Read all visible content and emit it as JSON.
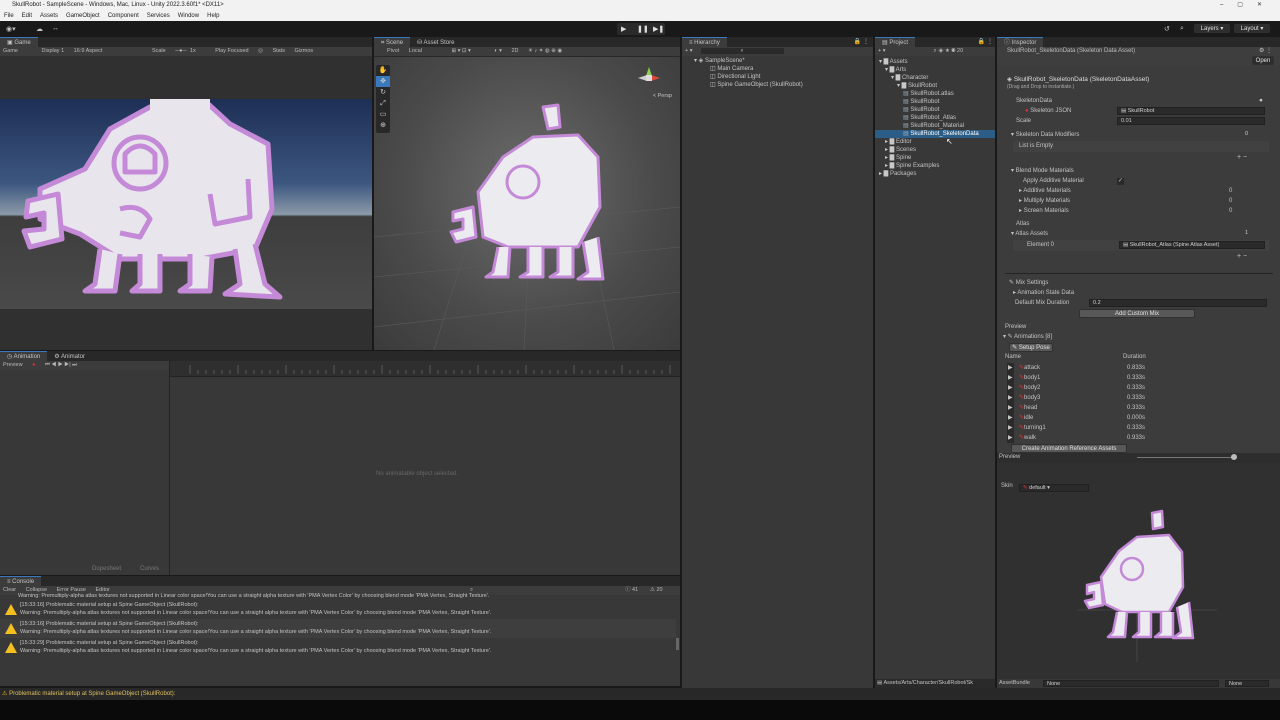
{
  "titlebar": {
    "title": "SkullRobot - SampleScene - Windows, Mac, Linux - Unity 2022.3.60f1* <DX11>"
  },
  "menu": [
    "File",
    "Edit",
    "Assets",
    "GameObject",
    "Component",
    "Services",
    "Window",
    "Help"
  ],
  "toolbar": {
    "layers": "Layers",
    "layout": "Layout"
  },
  "game": {
    "tab": "Game",
    "display_mode": "Game",
    "display": "Display 1",
    "aspect": "16:9 Aspect",
    "scale_label": "Scale",
    "scale_value": "1x",
    "play_focused": "Play Focused",
    "stats": "Stats",
    "gizmos": "Gizmos"
  },
  "scene": {
    "tab": "Scene",
    "asset_store_tab": "Asset Store",
    "pivot": "Pivot",
    "local": "Local",
    "persp": "< Persp",
    "mode_2d": "2D"
  },
  "animation": {
    "tab": "Animation",
    "animator_tab": "Animator",
    "preview": "Preview",
    "empty": "No animatable object selected.",
    "dopesheet": "Dopesheet",
    "curves": "Curves"
  },
  "hierarchy": {
    "tab": "Hierarchy",
    "scene": "SampleScene*",
    "items": [
      "Main Camera",
      "Directional Light",
      "Spine GameObject (SkullRobot)"
    ]
  },
  "project": {
    "tab": "Project",
    "tree": [
      {
        "label": "Assets",
        "depth": 0
      },
      {
        "label": "Arts",
        "depth": 1
      },
      {
        "label": "Character",
        "depth": 2
      },
      {
        "label": "SkullRobot",
        "depth": 3
      },
      {
        "label": "SkullRobot.atlas",
        "depth": 4
      },
      {
        "label": "SkullRobot",
        "depth": 4
      },
      {
        "label": "SkullRobot",
        "depth": 4
      },
      {
        "label": "SkullRobot_Atlas",
        "depth": 4
      },
      {
        "label": "SkullRobot_Material",
        "depth": 4
      },
      {
        "label": "SkullRobot_SkeletonData",
        "depth": 4
      },
      {
        "label": "Editor",
        "depth": 1
      },
      {
        "label": "Scenes",
        "depth": 1
      },
      {
        "label": "Spine",
        "depth": 1
      },
      {
        "label": "Spine Examples",
        "depth": 1
      },
      {
        "label": "Packages",
        "depth": 0
      }
    ],
    "path": "Assets/Arts/Character/SkullRobot/Sk"
  },
  "inspector": {
    "tab": "Inspector",
    "header": "SkullRobot_SkeletonData (Skeleton Data Asset)",
    "open": "Open",
    "asset_title": "SkullRobot_SkeletonData (SkeletonDataAsset)",
    "hint": "(Drag and Drop to instantiate.)",
    "skeleton_data": "SkeletonData",
    "skeleton_json_label": "Skeleton JSON",
    "skeleton_json_value": "SkullRobot",
    "scale_label": "Scale",
    "scale_value": "0.01",
    "modifiers_label": "Skeleton Data Modifiers",
    "modifiers_count": "0",
    "list_empty": "List is Empty",
    "blend_modes": "Blend Mode Materials",
    "apply_additive": "Apply Additive Material",
    "additive": "Additive Materials",
    "multiply": "Multiply Materials",
    "screen": "Screen Materials",
    "zero": "0",
    "atlas": "Atlas",
    "atlas_assets": "Atlas Assets",
    "atlas_count": "1",
    "element0": "Element 0",
    "element0_value": "SkullRobot_Atlas (Spine Atlas Asset)",
    "mix_settings": "Mix Settings",
    "anim_state": "Animation State Data",
    "default_mix": "Default Mix Duration",
    "default_mix_value": "0.2",
    "add_mix": "Add Custom Mix",
    "preview": "Preview",
    "animations": "Animations [8]",
    "setup_pose": "Setup Pose",
    "col_name": "Name",
    "col_duration": "Duration",
    "anims": [
      {
        "name": "attack",
        "dur": "0.833s"
      },
      {
        "name": "body1",
        "dur": "0.333s"
      },
      {
        "name": "body2",
        "dur": "0.333s"
      },
      {
        "name": "body3",
        "dur": "0.333s"
      },
      {
        "name": "head",
        "dur": "0.333s"
      },
      {
        "name": "idle",
        "dur": "0.000s"
      },
      {
        "name": "turning1",
        "dur": "0.333s"
      },
      {
        "name": "walk",
        "dur": "0.933s"
      }
    ],
    "create_ref": "Create Animation Reference Assets",
    "preview_bar": "Preview",
    "skin_label": "Skin",
    "skin_value": "default",
    "assetbundle": "AssetBundle",
    "none": "None"
  },
  "console": {
    "tab": "Console",
    "clear": "Clear",
    "collapse": "Collapse",
    "error_pause": "Error Pause",
    "editor": "Editor",
    "count_a": "41",
    "count_b": "20",
    "top_line": "Warning: Premultiply-alpha atlas textures not supported in Linear color space!You can use a straight alpha texture with 'PMA Vertex Color' by choosing blend mode 'PMA Vertex, Straight Texture'.",
    "entries": [
      {
        "l1": "[15:33:16] Problematic material setup at Spine GameObject (SkullRobot):",
        "l2": "Warning: Premultiply-alpha atlas textures not supported in Linear color space!You can use a straight alpha texture with 'PMA Vertex Color' by choosing blend mode 'PMA Vertex, Straight Texture'."
      },
      {
        "l1": "[15:33:16] Problematic material setup at Spine GameObject (SkullRobot):",
        "l2": "Warning: Premultiply-alpha atlas textures not supported in Linear color space!You can use a straight alpha texture with 'PMA Vertex Color' by choosing blend mode 'PMA Vertex, Straight Texture'."
      },
      {
        "l1": "[15:33:29] Problematic material setup at Spine GameObject (SkullRobot):",
        "l2": "Warning: Premultiply-alpha atlas textures not supported in Linear color space!You can use a straight alpha texture with 'PMA Vertex Color' by choosing blend mode 'PMA Vertex, Straight Texture'."
      }
    ]
  },
  "statusbar": {
    "text": "Problematic material setup at Spine GameObject (SkullRobot):"
  },
  "colors": {
    "accent": "#3a79bb",
    "selection": "#2c5d87",
    "warning": "#f4c020",
    "robot_outline": "#c48ad8"
  }
}
